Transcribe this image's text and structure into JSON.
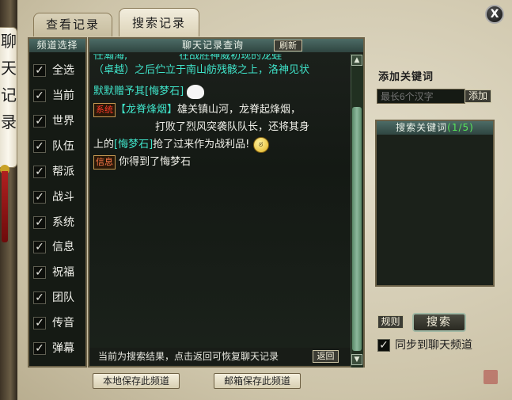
{
  "side_label": [
    "聊",
    "天",
    "记",
    "录"
  ],
  "tabs": [
    {
      "label": "查看记录"
    },
    {
      "label": "搜索记录"
    }
  ],
  "close_label": "X",
  "channels": {
    "header": "频道选择",
    "items": [
      {
        "label": "全选",
        "checked": true
      },
      {
        "label": "当前",
        "checked": true
      },
      {
        "label": "世界",
        "checked": true
      },
      {
        "label": "队伍",
        "checked": true
      },
      {
        "label": "帮派",
        "checked": true
      },
      {
        "label": "战斗",
        "checked": true
      },
      {
        "label": "系统",
        "checked": true
      },
      {
        "label": "信息",
        "checked": true
      },
      {
        "label": "祝福",
        "checked": true
      },
      {
        "label": "团队",
        "checked": true
      },
      {
        "label": "传音",
        "checked": true
      },
      {
        "label": "弹幕",
        "checked": true
      }
    ],
    "check_glyph": "✓"
  },
  "chat": {
    "title": "聊天记录查询",
    "refresh_label": "刷新",
    "lines": {
      "l1": "任瀚海,",
      "l1b": "在战胜神威初现的龙蛙",
      "l2": "（卓越）之后伫立于南山舫残骸之上，洛神见状",
      "l3a": "默默赠予其",
      "l3b": "[悔梦石]",
      "l4_tag": "系统",
      "l4a": "【龙脊烽烟】",
      "l4b": "雄关镇山河，龙脊起烽烟，",
      "l5a": "",
      "l5b": "打败了烈风突袭队队长，还将其身",
      "l6a": "上的",
      "l6b": "[悔梦石]",
      "l6c": "抢了过来作为战利品!",
      "l7_tag": "信息",
      "l7": "你得到了悔梦石"
    },
    "footer_text": "当前为搜索结果，点击返回可恢复聊天记录",
    "return_label": "返回"
  },
  "bottom_buttons": {
    "save_local": "本地保存此频道",
    "save_mail": "邮箱保存此频道"
  },
  "keywords": {
    "add_title": "添加关键词",
    "input_placeholder": "最长6个汉字",
    "add_label": "添加",
    "panel_title": "搜索关键词",
    "count": "(1/5)"
  },
  "actions": {
    "rules_label": "规则",
    "search_label": "搜索",
    "sync_label": "同步到聊天频道",
    "sync_checked": true
  },
  "colors": {
    "system_text": "#3fe3c9",
    "highlight": "#e0281e",
    "count_green": "#58e65a"
  }
}
